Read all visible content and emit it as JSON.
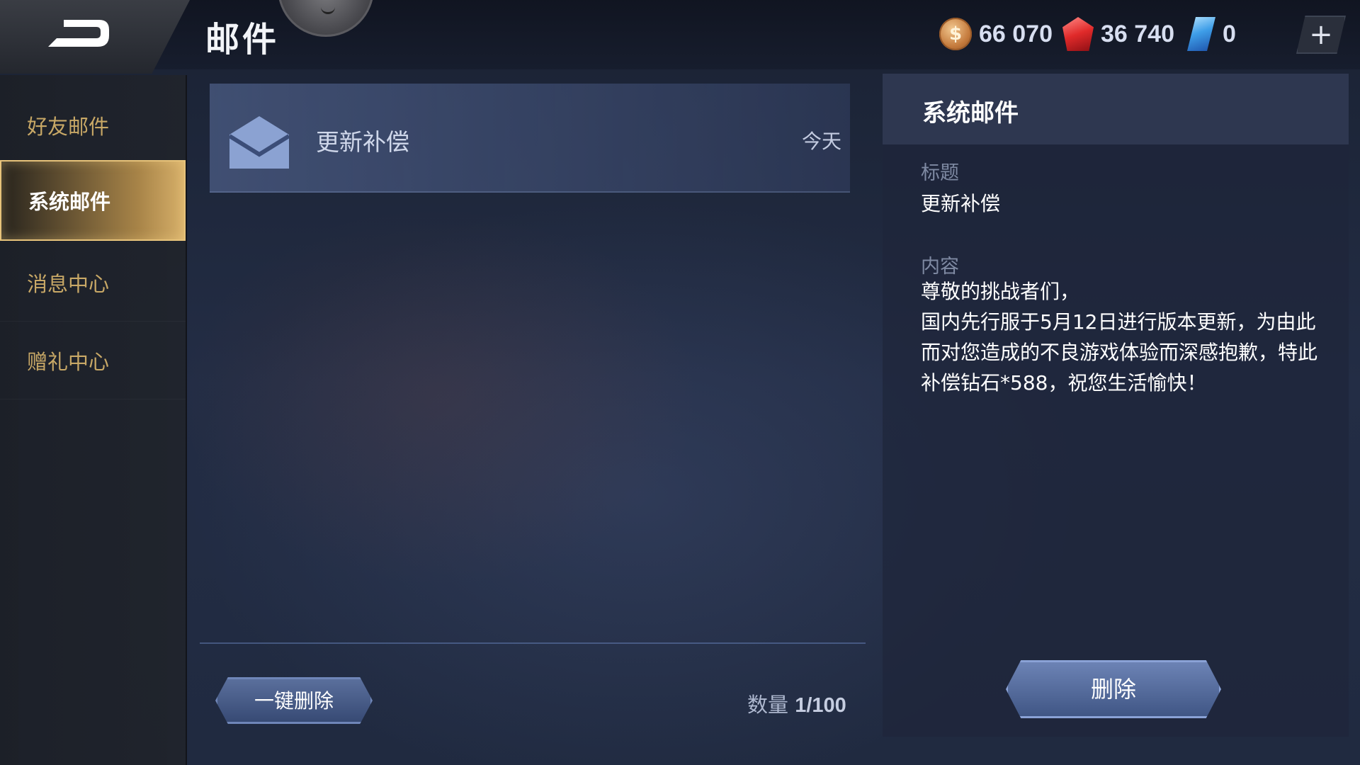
{
  "header": {
    "title": "邮件",
    "currencies": [
      {
        "name": "coin",
        "icon": "coin-icon",
        "value": "66 070",
        "symbol": "$"
      },
      {
        "name": "gem",
        "icon": "ruby-icon",
        "value": "36 740"
      },
      {
        "name": "crystal",
        "icon": "crystal-icon",
        "value": "0"
      }
    ],
    "plus_label": "+"
  },
  "sidebar": {
    "items": [
      {
        "label": "好友邮件",
        "active": false
      },
      {
        "label": "系统邮件",
        "active": true
      },
      {
        "label": "消息中心",
        "active": false
      },
      {
        "label": "赠礼中心",
        "active": false
      }
    ]
  },
  "mail_list": {
    "items": [
      {
        "subject": "更新补偿",
        "date": "今天"
      }
    ],
    "bulk_delete_label": "一键删除",
    "count_label": "数量",
    "count_value": "1/100"
  },
  "detail": {
    "header": "系统邮件",
    "title_label": "标题",
    "title_value": "更新补偿",
    "content_label": "内容",
    "content_text": "尊敬的挑战者们，\n国内先行服于5月12日进行版本更新，为由此而对您造成的不良游戏体验而深感抱歉，特此补偿钻石*588，祝您生活愉快！",
    "delete_label": "删除"
  }
}
